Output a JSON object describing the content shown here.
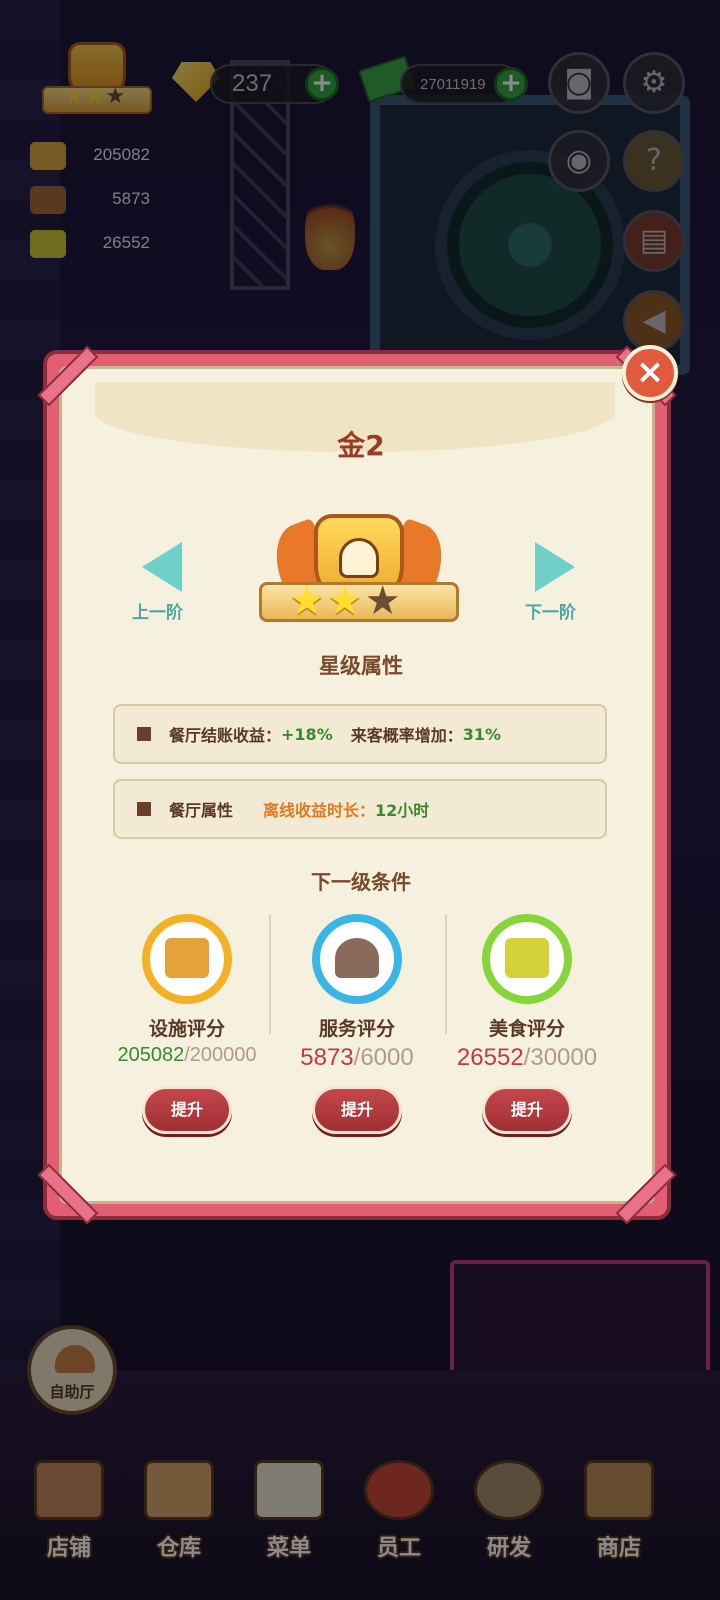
{
  "hud": {
    "gems": "237",
    "cash": "27011919",
    "trophy_stars_lit": 2,
    "trophy_stars_total": 3,
    "facility_score": "205082",
    "service_score": "5873",
    "food_score": "26552"
  },
  "dialog": {
    "title": "金2",
    "prev_label": "上一阶",
    "next_label": "下一阶",
    "badge_stars_lit": 2,
    "badge_stars_total": 3,
    "star_attr_heading": "星级属性",
    "attr1_label": "餐厅结账收益：",
    "attr1_value": "+18%",
    "attr1b_label": "来客概率增加：",
    "attr1b_value": "31%",
    "attr2_label": "餐厅属性",
    "attr2_key": "离线收益时长：",
    "attr2_value": "12小时",
    "next_level_heading": "下一级条件",
    "close_icon": "×",
    "conditions": [
      {
        "name": "设施评分",
        "current": "205082",
        "target": "/200000",
        "current_color": "#3b8a2a",
        "ring_color": "#f3b225",
        "button": "提升"
      },
      {
        "name": "服务评分",
        "current": "5873",
        "target": "/6000",
        "current_color": "#c23a4a",
        "ring_color": "#39b6e6",
        "button": "提升"
      },
      {
        "name": "美食评分",
        "current": "26552",
        "target": "/30000",
        "current_color": "#c23a4a",
        "ring_color": "#86d63a",
        "button": "提升"
      }
    ]
  },
  "self_service_label": "自助厅",
  "bottom_nav": [
    {
      "label": "店铺"
    },
    {
      "label": "仓库"
    },
    {
      "label": "菜单"
    },
    {
      "label": "员工"
    },
    {
      "label": "研发"
    },
    {
      "label": "商店"
    }
  ],
  "colors": {
    "dialog_frame": "#e25e72",
    "dialog_bg": "#f6f0df",
    "title": "#9a3a22",
    "button": "#a02f34"
  },
  "icons": [
    "camera-icon",
    "gear-icon",
    "eye-icon",
    "help-book-icon",
    "close-icon"
  ]
}
